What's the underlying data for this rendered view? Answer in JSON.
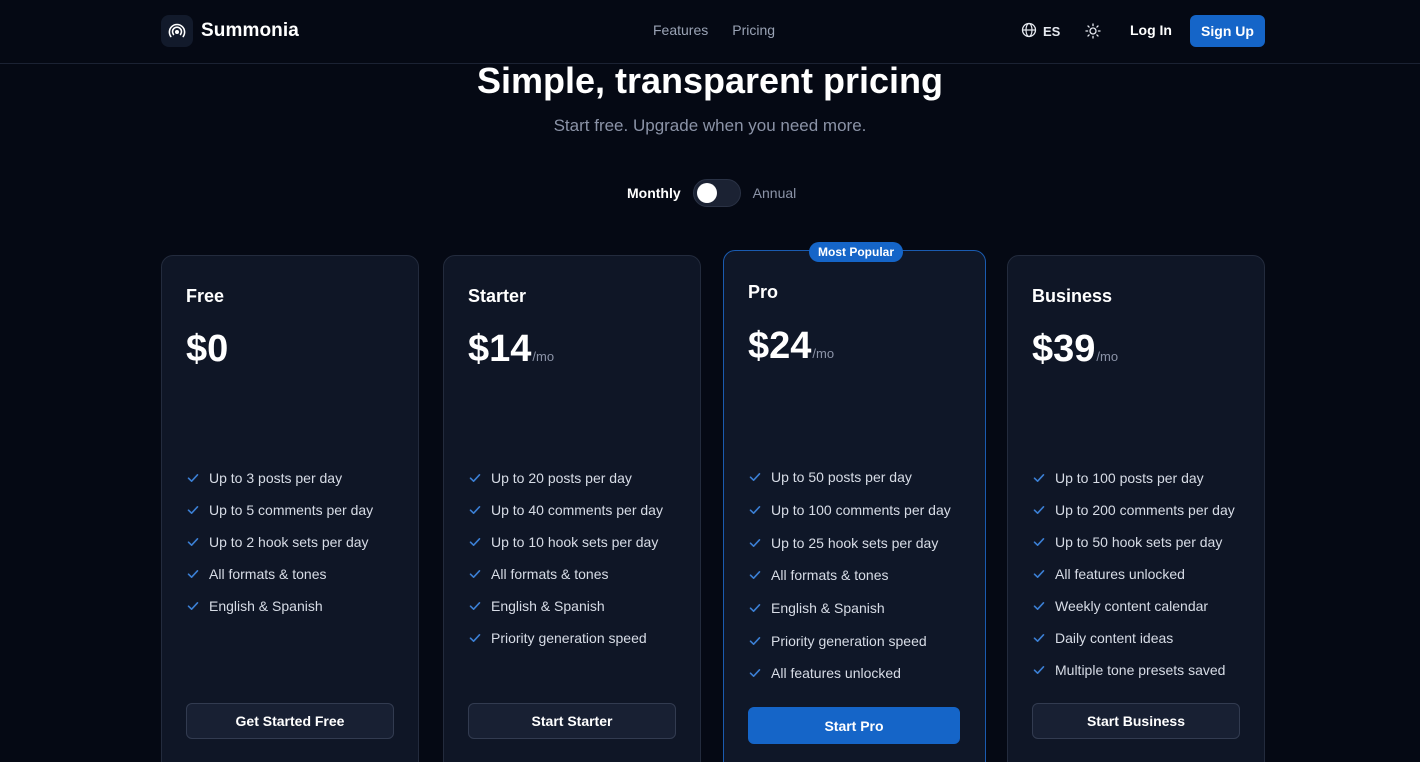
{
  "brand": {
    "name": "Summonia"
  },
  "nav": {
    "features": "Features",
    "pricing": "Pricing"
  },
  "header": {
    "language": "ES",
    "login": "Log In",
    "signup": "Sign Up"
  },
  "hero": {
    "title": "Simple, transparent pricing",
    "subtitle": "Start free. Upgrade when you need more."
  },
  "billing": {
    "monthly": "Monthly",
    "annual": "Annual",
    "annual_enabled": false
  },
  "colors": {
    "accent": "#1565c8",
    "background": "#050914",
    "card": "#0f1626",
    "check": "#3b7fd4"
  },
  "plans": [
    {
      "name": "Free",
      "price": "$0",
      "period": "",
      "features": [
        "Up to 3 posts per day",
        "Up to 5 comments per day",
        "Up to 2 hook sets per day",
        "All formats & tones",
        "English & Spanish"
      ],
      "cta": "Get Started Free"
    },
    {
      "name": "Starter",
      "price": "$14",
      "period": "/mo",
      "features": [
        "Up to 20 posts per day",
        "Up to 40 comments per day",
        "Up to 10 hook sets per day",
        "All formats & tones",
        "English & Spanish",
        "Priority generation speed"
      ],
      "cta": "Start Starter"
    },
    {
      "name": "Pro",
      "price": "$24",
      "period": "/mo",
      "badge": "Most Popular",
      "features": [
        "Up to 50 posts per day",
        "Up to 100 comments per day",
        "Up to 25 hook sets per day",
        "All formats & tones",
        "English & Spanish",
        "Priority generation speed",
        "All features unlocked"
      ],
      "cta": "Start Pro"
    },
    {
      "name": "Business",
      "price": "$39",
      "period": "/mo",
      "features": [
        "Up to 100 posts per day",
        "Up to 200 comments per day",
        "Up to 50 hook sets per day",
        "All features unlocked",
        "Weekly content calendar",
        "Daily content ideas",
        "Multiple tone presets saved"
      ],
      "cta": "Start Business"
    }
  ]
}
